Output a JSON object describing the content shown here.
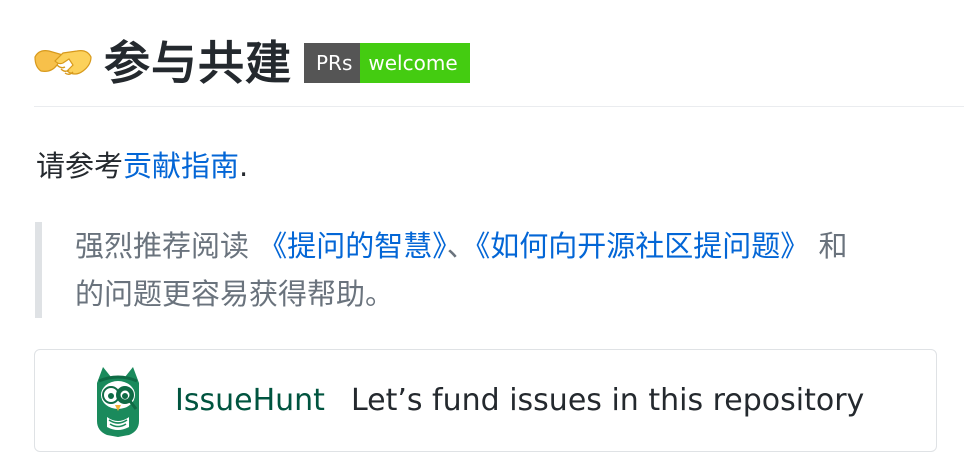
{
  "heading": {
    "icon": "handshake-icon",
    "title": "参与共建",
    "badge": {
      "left_text": "PRs",
      "right_text": "welcome",
      "left_color": "#555555",
      "right_color": "#44cc11"
    }
  },
  "paragraph": {
    "prefix": "请参考",
    "link_text": "贡献指南",
    "suffix": "."
  },
  "blockquote": {
    "text_1": "强烈推荐阅读 ",
    "link_1": "《提问的智慧》",
    "separator": "、",
    "link_2": "《如何向开源社区提问题》",
    "text_2": " 和",
    "line_2": "的问题更容易获得帮助。"
  },
  "issuehunt_card": {
    "icon": "owl-icon",
    "brand_name": "IssueHunt",
    "tagline": "Let’s fund issues in this repository",
    "brand_color": "#00543f"
  }
}
